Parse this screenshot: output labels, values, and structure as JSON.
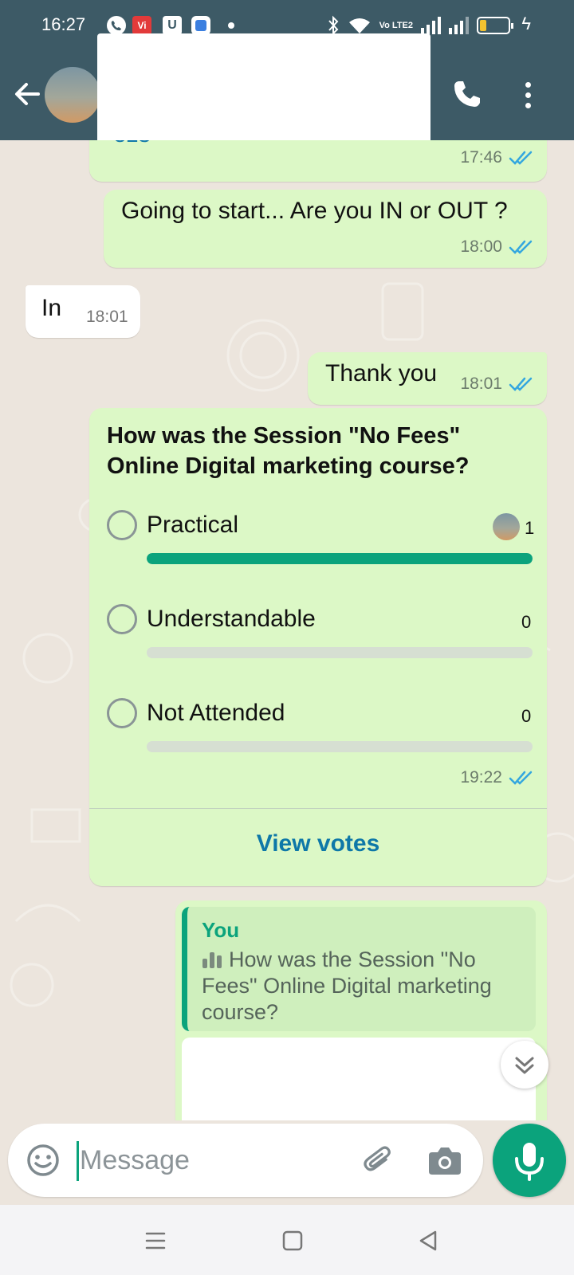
{
  "status_bar": {
    "time": "16:27",
    "volte": "Vo LTE2",
    "icons": [
      "call-icon",
      "vi-icon",
      "u-icon",
      "app-icon",
      "bluetooth-icon",
      "wifi-icon",
      "signal-icon",
      "battery-icon",
      "charging-icon"
    ]
  },
  "header": {
    "back_icon": "arrow-left-icon",
    "call_icon": "phone-icon",
    "menu_icon": "more-vert-icon"
  },
  "messages": [
    {
      "direction": "out",
      "text": "-ezs",
      "time": "17:46"
    },
    {
      "direction": "out",
      "text": "Going to start... Are you IN or OUT ?",
      "time": "18:00"
    },
    {
      "direction": "in",
      "text": "In",
      "time": "18:01"
    },
    {
      "direction": "out",
      "text": "Thank you",
      "time": "18:01"
    }
  ],
  "poll": {
    "question": "How was the Session \"No Fees\" Online Digital marketing course?",
    "options": [
      {
        "label": "Practical",
        "votes": "1",
        "fraction": 1.0
      },
      {
        "label": "Understandable",
        "votes": "0",
        "fraction": 0.0
      },
      {
        "label": "Not Attended",
        "votes": "0",
        "fraction": 0.0
      }
    ],
    "time": "19:22",
    "view_votes": "View votes"
  },
  "reply": {
    "name": "You",
    "quoted_text": "How was the Session \"No Fees\" Online Digital marketing course?"
  },
  "composer": {
    "placeholder": "Message"
  },
  "colors": {
    "header": "#3d5a66",
    "outgoing_bubble": "#dcf8c6",
    "accent": "#0ba37c",
    "read_ticks": "#34a7df",
    "link": "#0e78a8"
  }
}
